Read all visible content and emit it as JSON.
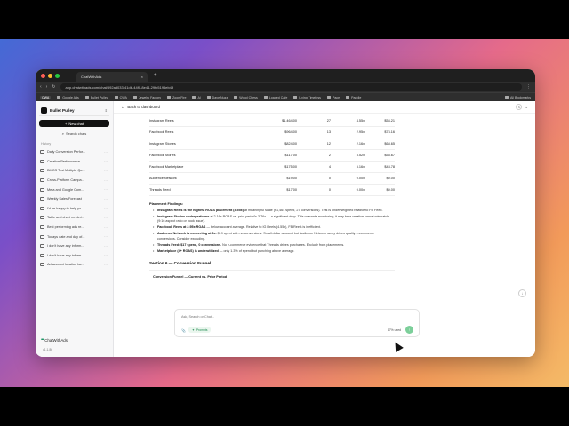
{
  "browser": {
    "tab_title": "ChatWithAds",
    "tab_close": "×",
    "new_tab": "+",
    "url": "app.chatwithads.com/chat/592ad033-41db-44f0-8e44-29fb5195eb49",
    "bookmarks": [
      "CWA",
      "Google Ads",
      "Bullet Pulley",
      "CWA",
      "Jewelry Factory",
      "ZoomFire",
      "Al",
      "Dave Nuzz",
      "Wood Chess",
      "Loaded Cafe",
      "Living Timeless",
      "Pace",
      "Paddle"
    ],
    "all_bookmarks": "All Bookmarks"
  },
  "sidebar": {
    "workspace": "Bullet Pulley",
    "new_chat": "New chat",
    "search": "Search chats",
    "history_label": "History",
    "history": [
      "Daily Conversion Perfor...",
      "Creative Performance ...",
      "BMOS Test Multiple Qu...",
      "Cross-Platform Campa...",
      "Meta and Google Com...",
      "Weekly Sales Forecast",
      "I'd be happy to help yo...",
      "Table and chart renderi...",
      "Best performing ads re...",
      "Todays date and day of...",
      "I don't have any inform...",
      "I don't have any inform...",
      "Ad account location ba..."
    ],
    "more": "···",
    "brand": "ChatWithAds",
    "version": "v1.1.86"
  },
  "main": {
    "back": "Back to dashboard",
    "user_initial": "S",
    "placements": [
      [
        "Instagram Reels",
        "$1,464.00",
        "27",
        "4.55x",
        "$54.21"
      ],
      [
        "Facebook Reels",
        "$964.00",
        "13",
        "2.95x",
        "$74.16"
      ],
      [
        "Instagram Stories",
        "$824.00",
        "12",
        "2.16x",
        "$68.65"
      ],
      [
        "Facebook Stories",
        "$117.00",
        "2",
        "5.52x",
        "$58.67"
      ],
      [
        "Facebook Marketplace",
        "$175.00",
        "4",
        "5.16x",
        "$43.78"
      ],
      [
        "Audience Network",
        "$19.00",
        "0",
        "0.00x",
        "$0.00"
      ],
      [
        "Threads Feed",
        "$17.00",
        "0",
        "0.00x",
        "$0.00"
      ]
    ],
    "findings_title": "Placement Findings:",
    "findings": [
      {
        "b": "Instagram Reels is the highest ROAS placement (4.55x)",
        "t": " at meaningful scale ($1,464 spend, 27 conversions). This is underweighted relative to FB Feed."
      },
      {
        "b": "Instagram Stories underperforms",
        "t": " at 2.16x ROAS vs. prior period's 3.76x — a significant drop. This warrants monitoring; it may be a creative format mismatch (9:16 aspect ratio or hook issue)."
      },
      {
        "b": "Facebook Reels at 2.95x ROAS",
        "t": " — below account average. Relative to IG Reels (4.55x), FB Reels is inefficient."
      },
      {
        "b": "Audience Network is converting at 0x.",
        "t": " $19 spent with no conversions. Small dollar amount, but Audience Network rarely drives quality e-commerce conversions. Consider excluding."
      },
      {
        "b": "Threads Feed: $17 spend, 0 conversions.",
        "t": " No e-commerce evidence that Threads drives purchases. Exclude from placements."
      },
      {
        "b": "Marketplace (4+ ROAS) is underutilized",
        "t": " — only 1.3% of spend but punching above average."
      }
    ],
    "section": "Section 6 — Conversion Funnel",
    "funnel_title": "Conversion Funnel — Current vs. Prior Period",
    "scroll_down": "↓"
  },
  "composer": {
    "placeholder": "Ask, Search or Chat...",
    "attach": "📎",
    "prompts": "Prompts",
    "usage": "17% used",
    "send": "↑"
  }
}
